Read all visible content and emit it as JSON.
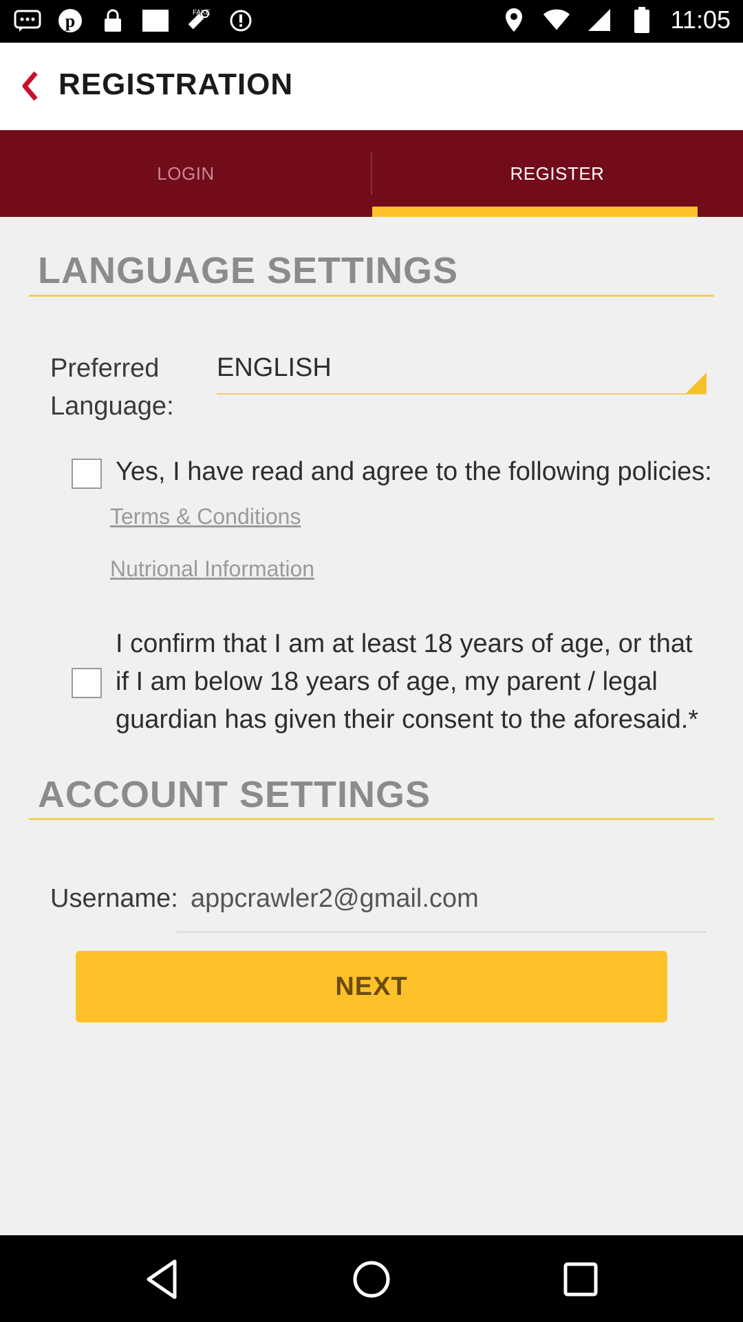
{
  "status_bar": {
    "time": "11:05",
    "left_icons": [
      "chat-icon",
      "pinterest-icon",
      "lock-icon",
      "screen-icon",
      "fake-gps-icon",
      "sync-icon"
    ],
    "right_icons": [
      "location-icon",
      "wifi-icon",
      "signal-icon",
      "battery-icon"
    ]
  },
  "app_bar": {
    "title": "REGISTRATION",
    "back_icon": "chevron-left-icon"
  },
  "tabs": [
    {
      "label": "LOGIN",
      "active": false
    },
    {
      "label": "REGISTER",
      "active": true
    }
  ],
  "language_section": {
    "title": "LANGUAGE SETTINGS",
    "preferred_label_line1": "Preferred",
    "preferred_label_line2": "Language:",
    "selected_language": "ENGLISH",
    "policies_checkbox_text": "Yes, I have read and agree to the following policies:",
    "policies_checked": false,
    "links": [
      "Terms & Conditions",
      "Nutrional Information"
    ],
    "age_confirm_line1": "I confirm that I am at least 18 years of age, or that",
    "age_confirm_line2": "if I am below 18 years of age, my parent / legal",
    "age_confirm_line3": "guardian has given their consent to the aforesaid.*",
    "age_checked": false
  },
  "account_section": {
    "title": "ACCOUNT SETTINGS",
    "username_label": "Username:",
    "username_value": "appcrawler2@gmail.com"
  },
  "next_button": "NEXT",
  "colors": {
    "brand_red": "#720c1a",
    "accent_yellow": "#fdc22a",
    "background": "#f0f0f0"
  },
  "nav_bar": [
    "back-icon",
    "home-icon",
    "recents-icon"
  ]
}
